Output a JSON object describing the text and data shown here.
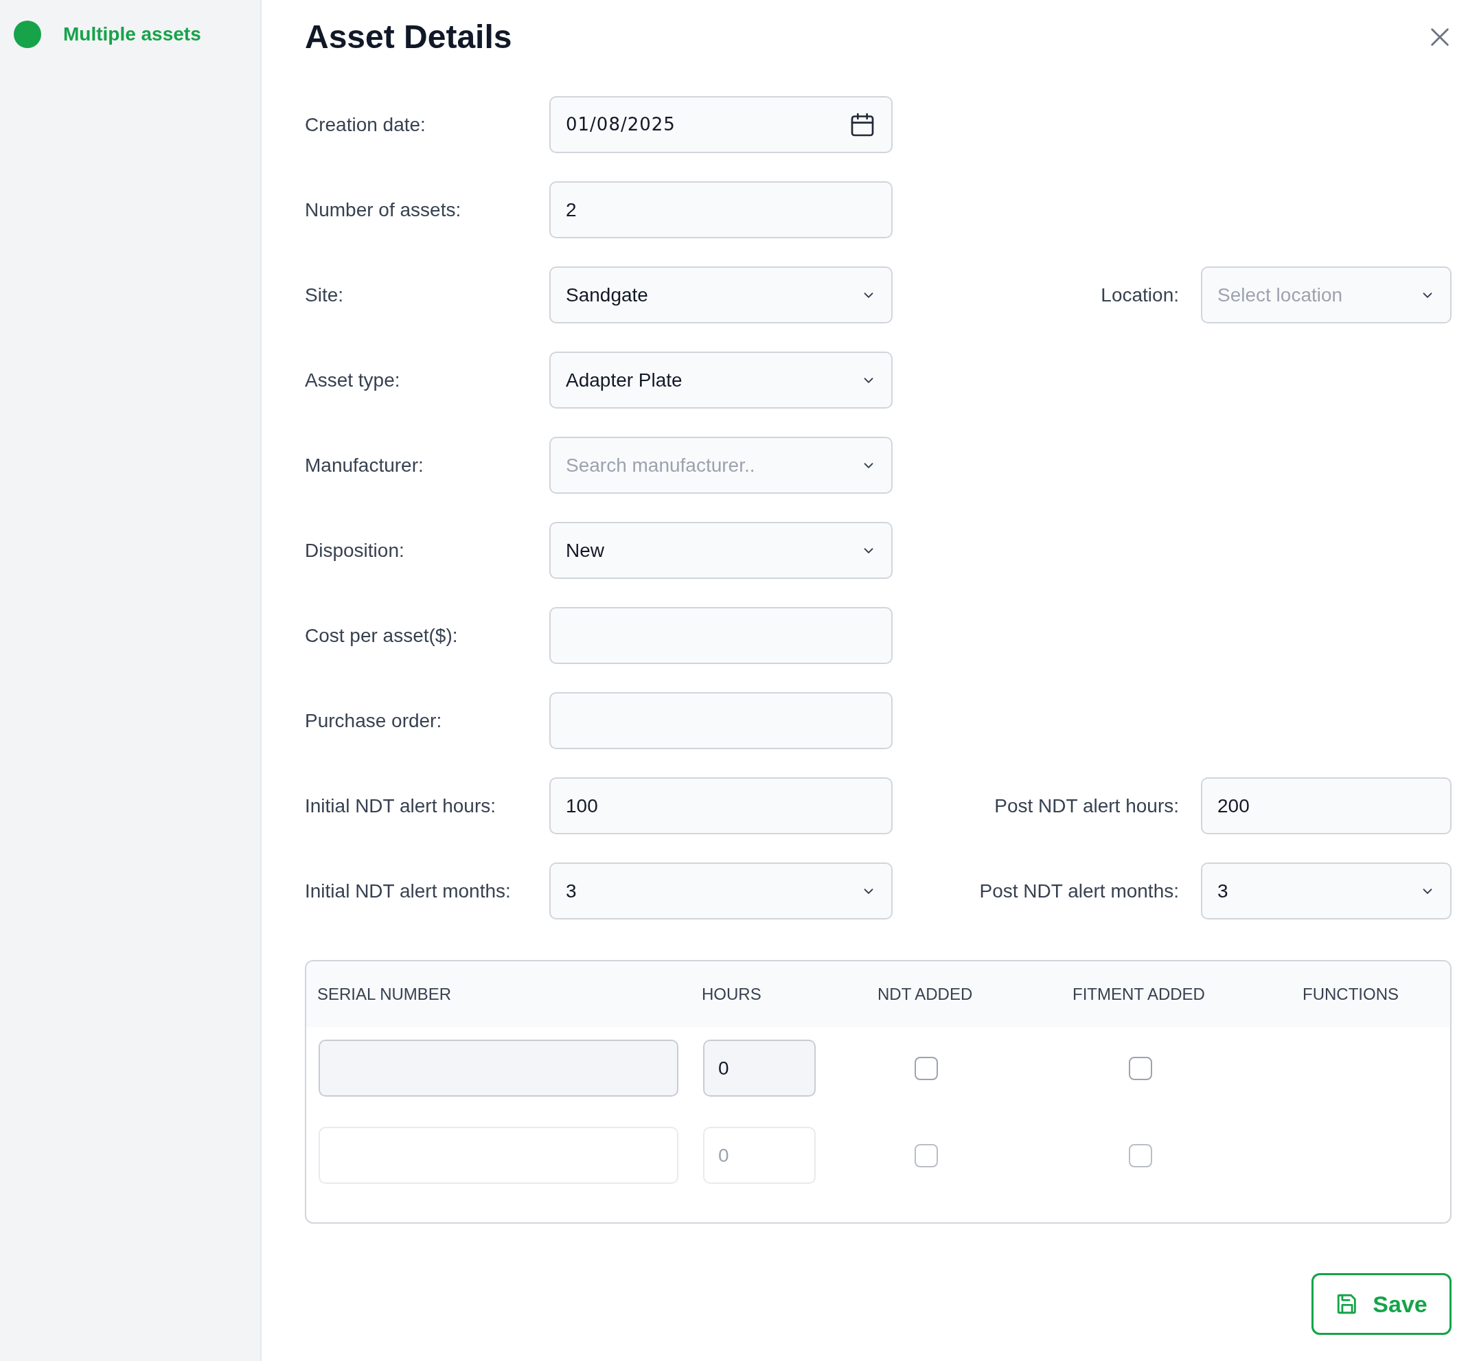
{
  "sidebar": {
    "items": [
      {
        "label": "Multiple assets",
        "color": "#16a34a",
        "selected": true
      }
    ]
  },
  "title": "Asset Details",
  "form_rows": [
    {
      "left": {
        "label": "Creation date:",
        "kind": "date",
        "value": "01/08/2025"
      }
    },
    {
      "left": {
        "label": "Number of assets:",
        "kind": "text",
        "value": "2"
      }
    },
    {
      "left": {
        "label": "Site:",
        "kind": "select",
        "value": "Sandgate"
      },
      "right": {
        "label": "Location:",
        "kind": "select",
        "placeholder": "Select location"
      }
    },
    {
      "left": {
        "label": "Asset type:",
        "kind": "select",
        "value": "Adapter Plate"
      }
    },
    {
      "left": {
        "label": "Manufacturer:",
        "kind": "select",
        "placeholder": "Search manufacturer.."
      }
    },
    {
      "left": {
        "label": "Disposition:",
        "kind": "select",
        "value": "New"
      }
    },
    {
      "left": {
        "label": "Cost per asset($):",
        "kind": "text"
      }
    },
    {
      "left": {
        "label": "Purchase order:",
        "kind": "text"
      }
    },
    {
      "left": {
        "label": "Initial NDT alert hours:",
        "kind": "text",
        "value": "100"
      },
      "right": {
        "label": "Post NDT alert hours:",
        "kind": "text",
        "value": "200"
      }
    },
    {
      "left": {
        "label": "Initial NDT alert months:",
        "kind": "select",
        "value": "3"
      },
      "right": {
        "label": "Post NDT alert months:",
        "kind": "select",
        "value": "3"
      }
    }
  ],
  "table": {
    "columns": [
      "SERIAL NUMBER",
      "HOURS",
      "NDT ADDED",
      "FITMENT ADDED",
      "FUNCTIONS"
    ],
    "rows": [
      {
        "hours": "0",
        "ndt_added": false,
        "fitment_added": false,
        "disabled": false
      },
      {
        "hours": "0",
        "ndt_added": false,
        "fitment_added": false,
        "disabled": true
      }
    ]
  },
  "save_button": "Save"
}
